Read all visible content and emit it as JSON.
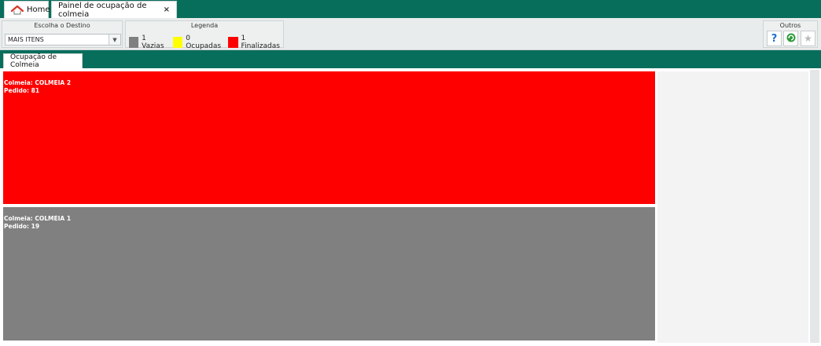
{
  "tabs": {
    "home_label": "Home",
    "painel_label": "Painel de ocupação de colmeia",
    "close_label": "×"
  },
  "toolbar": {
    "destino": {
      "title": "Escolha o Destino",
      "selected": "MAIS ITENS",
      "arrow": "▼"
    },
    "legenda": {
      "title": "Legenda",
      "items": [
        {
          "label": "1 Vazias",
          "color": "#808080"
        },
        {
          "label": "0 Ocupadas",
          "color": "#ffff00"
        },
        {
          "label": "1 Finalizadas",
          "color": "#ff0000"
        }
      ]
    },
    "outros": {
      "title": "Outros",
      "help_label": "?",
      "refresh_icon": "refresh-icon",
      "star_icon": "star-icon"
    }
  },
  "section_tab": "Ocupação de Colmeia",
  "colmeias": [
    {
      "colmeia": "Colmeia: COLMEIA 2",
      "pedido": "Pedido: 81",
      "color": "#ff0000"
    },
    {
      "colmeia": "Colmeia: COLMEIA 1",
      "pedido": "Pedido: 19",
      "color": "#808080"
    }
  ],
  "colors": {
    "brand_green": "#086e5c"
  }
}
